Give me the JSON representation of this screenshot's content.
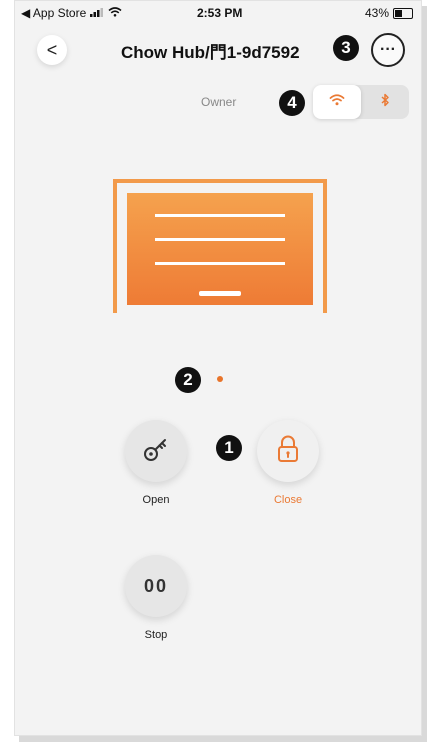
{
  "status_bar": {
    "back_app": "◀ App Store",
    "time": "2:53 PM",
    "battery": "43%",
    "battery_level": 0.43
  },
  "header": {
    "back_icon": "<",
    "title": "Chow Hub/門1-9d7592",
    "more_icon": "···"
  },
  "annotations": {
    "one": "1",
    "two": "2",
    "three": "3",
    "four": "4"
  },
  "owner_label": "Owner",
  "connection": {
    "active": "wifi",
    "options": [
      "wifi-icon",
      "bluetooth-icon"
    ]
  },
  "colors": {
    "accent": "#ea7a35",
    "door_top": "#f5a24e",
    "door_bottom": "#ee7b35"
  },
  "pager": {
    "current": 1,
    "total": 1
  },
  "actions": {
    "open": {
      "label": "Open",
      "icon": "key-icon"
    },
    "close": {
      "label": "Close",
      "icon": "lock-icon"
    },
    "stop": {
      "label": "Stop",
      "icon": "stop-icon",
      "glyph": "00"
    }
  }
}
